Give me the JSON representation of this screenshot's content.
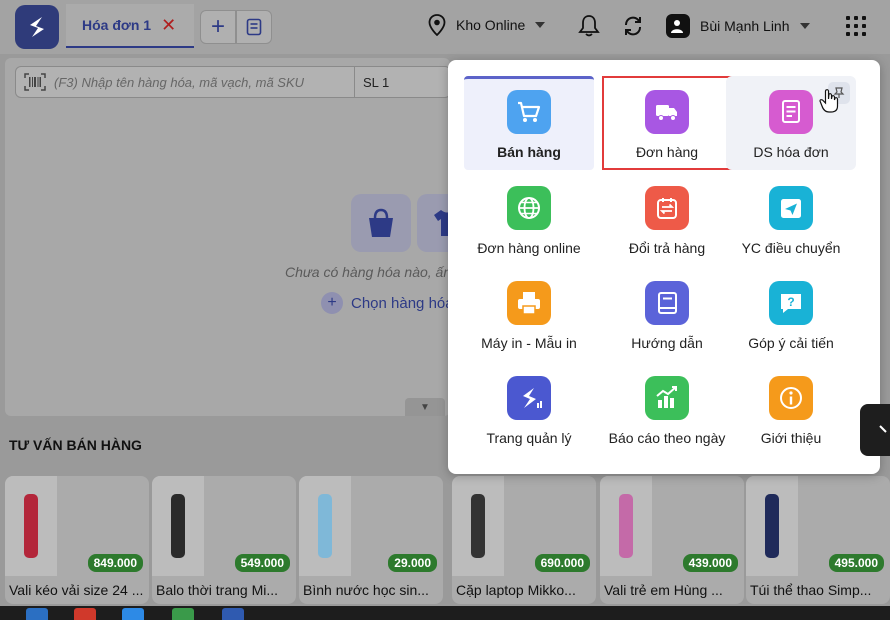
{
  "header": {
    "tab_label": "Hóa đơn 1",
    "close_symbol": "✕",
    "add_symbol": "+",
    "store_name": "Kho Online",
    "user_name": "Bùi Mạnh Linh",
    "icons": [
      "logo-icon",
      "note-icon",
      "location-icon",
      "chevron-down-icon",
      "bell-icon",
      "sync-icon",
      "user-badge-icon",
      "apps-grid-icon"
    ]
  },
  "cart": {
    "search_placeholder": "(F3) Nhập tên hàng hóa, mã vạch, mã SKU",
    "qty_label": "SL 1",
    "empty_text": "Chưa có hàng hóa nào, ấn",
    "choose_label": "Chọn hàng hóa",
    "collapse_symbol": "▼"
  },
  "suggestions": {
    "title": "TƯ VẤN BÁN HÀNG",
    "products": [
      {
        "name": "Vali kéo vải size 24 ...",
        "price": "849.000",
        "color": "#b3263a"
      },
      {
        "name": "Balo thời trang Mi...",
        "price": "549.000",
        "color": "#2a2a2a"
      },
      {
        "name": "Bình nước học sin...",
        "price": "29.000",
        "color": "#7fb8d8"
      },
      {
        "name": "Cặp laptop Mikko...",
        "price": "690.000",
        "color": "#333333"
      },
      {
        "name": "Vali trẻ em Hùng ...",
        "price": "439.000",
        "color": "#c46aa8"
      },
      {
        "name": "Túi thể thao Simp...",
        "price": "495.000",
        "color": "#1f2a5a"
      }
    ]
  },
  "menu": {
    "items": [
      {
        "label": "Bán hàng",
        "icon": "cart-icon",
        "color": "#4ea3f0"
      },
      {
        "label": "Đơn hàng",
        "icon": "delivery-truck-icon",
        "color": "#a857e3"
      },
      {
        "label": "DS hóa đơn",
        "icon": "invoice-list-icon",
        "color": "#d65bd0"
      },
      {
        "label": "Đơn hàng online",
        "icon": "globe-icon",
        "color": "#3cbf5a"
      },
      {
        "label": "Đổi trả hàng",
        "icon": "return-exchange-icon",
        "color": "#ee5a48"
      },
      {
        "label": "YC điều chuyển",
        "icon": "transfer-request-icon",
        "color": "#19b2d6"
      },
      {
        "label": "Máy in - Mẫu in",
        "icon": "printer-icon",
        "color": "#f59a1b"
      },
      {
        "label": "Hướng dẫn",
        "icon": "book-icon",
        "color": "#5b63d9"
      },
      {
        "label": "Góp ý cải tiến",
        "icon": "question-chat-icon",
        "color": "#19b2d6"
      },
      {
        "label": "Trang quản lý",
        "icon": "management-logo-icon",
        "color": "#4b58d0"
      },
      {
        "label": "Báo cáo theo ngày",
        "icon": "chart-report-icon",
        "color": "#3cbf5a"
      },
      {
        "label": "Giới thiệu",
        "icon": "info-icon",
        "color": "#f59a1b"
      }
    ]
  }
}
